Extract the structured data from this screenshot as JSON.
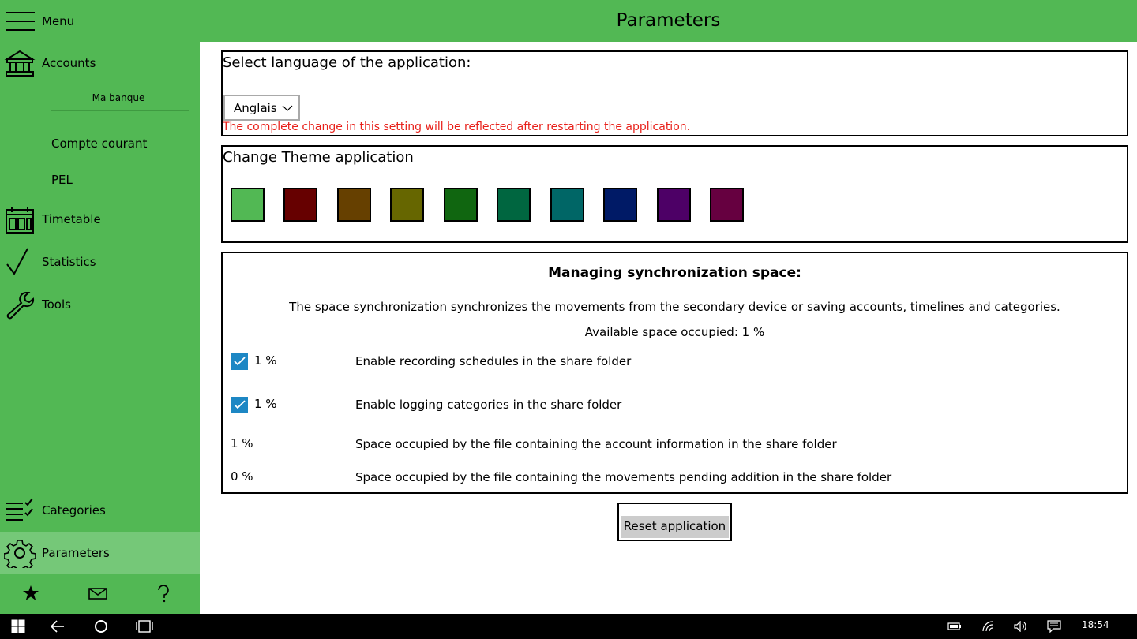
{
  "header": {
    "menu_label": "Menu",
    "title": "Parameters"
  },
  "sidebar": {
    "accounts_label": "Accounts",
    "bank_name": "Ma banque",
    "sub_accounts": [
      "Compte courant",
      "PEL"
    ],
    "timetable_label": "Timetable",
    "statistics_label": "Statistics",
    "tools_label": "Tools",
    "categories_label": "Categories",
    "parameters_label": "Parameters",
    "footer_icons": [
      "star-icon",
      "mail-icon",
      "help-icon"
    ]
  },
  "language": {
    "title": "Select language of the application:",
    "selected": "Anglais",
    "note": "The complete change in this setting will be reflected after restarting the application."
  },
  "theme": {
    "title": "Change Theme application",
    "colors": [
      "#52b854",
      "#660000",
      "#664000",
      "#666600",
      "#106610",
      "#006640",
      "#006666",
      "#001a66",
      "#4d0066",
      "#660040"
    ]
  },
  "sync": {
    "title": "Managing synchronization space:",
    "description": "The space synchronization synchronizes the movements from the secondary device or saving accounts, timelines and categories.",
    "available": "Available space occupied: 1 %",
    "rows": [
      {
        "percent": "1 %",
        "text": "Enable recording schedules in the share folder",
        "checked": true
      },
      {
        "percent": "1 %",
        "text": "Enable logging categories in the share folder",
        "checked": true
      },
      {
        "percent": "1 %",
        "text": "Space occupied by the file containing the account information in the share folder"
      },
      {
        "percent": "0 %",
        "text": "Space occupied by the file containing the movements pending addition in the share folder"
      }
    ]
  },
  "reset_label": "Reset application",
  "taskbar": {
    "clock": "18:54"
  },
  "colors": {
    "accent": "#52b854",
    "active_item": "#75c878",
    "warning_text": "#e8201a",
    "checkbox": "#1d87c4"
  }
}
